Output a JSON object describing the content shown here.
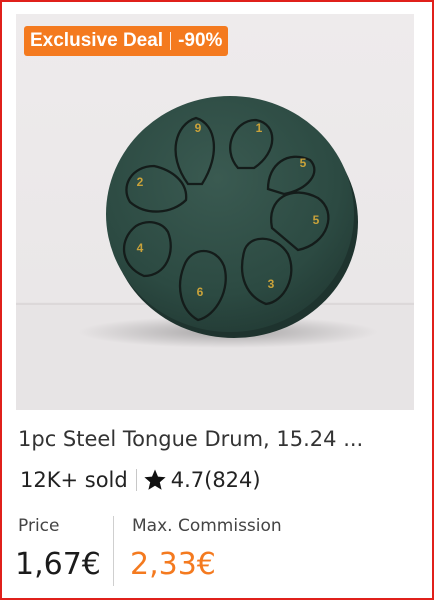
{
  "badge": {
    "label": "Exclusive Deal",
    "discount": "-90%"
  },
  "product": {
    "title": "1pc Steel Tongue Drum, 15.24 ...",
    "sold": "12K+ sold",
    "rating": "4.7",
    "reviews": "(824)",
    "image_alt": "Steel tongue drum product photo"
  },
  "drum_numbers": [
    "9",
    "1",
    "5",
    "5",
    "3",
    "6",
    "4",
    "2"
  ],
  "pricing": {
    "price_label": "Price",
    "price": "1,67€",
    "commission_label": "Max. Commission",
    "commission": "2,33€"
  },
  "colors": {
    "accent": "#f47a1f",
    "border": "#e0201b",
    "drum": "#2c4a42"
  },
  "icons": {
    "rating": "star-icon"
  }
}
